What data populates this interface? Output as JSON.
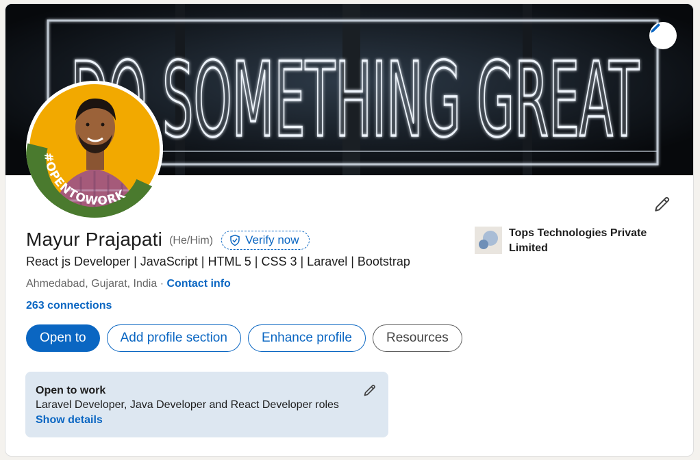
{
  "banner": {
    "neon_text_line": "DO SOMETHING GREAT",
    "edit_icon": "pencil-icon"
  },
  "avatar": {
    "badge_text": "#OPENTOWORK"
  },
  "profile": {
    "name": "Mayur Prajapati",
    "pronouns": "(He/Him)",
    "verify_label": "Verify now",
    "headline": "React js Developer | JavaScript | HTML 5 | CSS 3 | Laravel | Bootstrap",
    "location": "Ahmedabad, Gujarat, India",
    "separator": "·",
    "contact_info": "Contact info",
    "connections": "263 connections"
  },
  "company": {
    "name": "Tops Technologies Private Limited"
  },
  "actions": {
    "open_to": "Open to",
    "add_section": "Add profile section",
    "enhance": "Enhance profile",
    "resources": "Resources"
  },
  "open_to_work": {
    "title": "Open to work",
    "roles": "Laravel Developer, Java Developer and React Developer roles",
    "show_details": "Show details"
  },
  "colors": {
    "accent": "#0a66c2",
    "otw_green": "#4a7a2e",
    "avatar_bg": "#f2a900",
    "card_bg": "#dde7f1"
  }
}
